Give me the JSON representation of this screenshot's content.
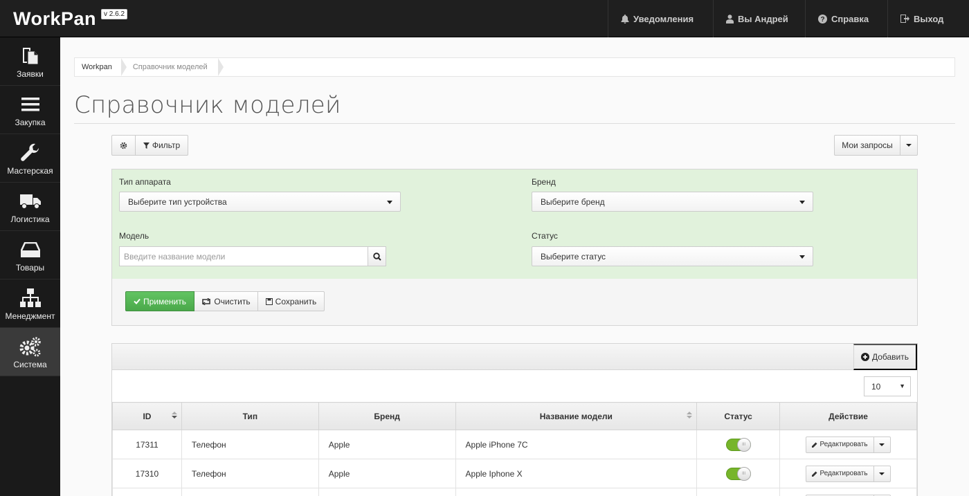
{
  "app": {
    "brand": "WorkPan",
    "version": "v 2.6.2"
  },
  "topnav": [
    {
      "label": "Уведомления",
      "icon": "bell-icon"
    },
    {
      "label": "Вы Андрей",
      "icon": "user-icon"
    },
    {
      "label": "Справка",
      "icon": "question-icon"
    },
    {
      "label": "Выход",
      "icon": "logout-icon"
    }
  ],
  "sidebar": {
    "items": [
      {
        "label": "Заявки",
        "icon": "documents-icon"
      },
      {
        "label": "Закупка",
        "icon": "menu-icon"
      },
      {
        "label": "Мастерская",
        "icon": "wrench-icon"
      },
      {
        "label": "Логистика",
        "icon": "truck-icon"
      },
      {
        "label": "Товары",
        "icon": "drive-icon"
      },
      {
        "label": "Менеджмент",
        "icon": "sitemap-icon"
      },
      {
        "label": "Система",
        "icon": "gears-icon",
        "active": true
      }
    ]
  },
  "breadcrumb": {
    "home": "Workpan",
    "current": "Справочник моделей"
  },
  "page": {
    "title": "Справочник моделей"
  },
  "toolbar": {
    "filter_label": "Фильтр",
    "saved_queries_label": "Мои запросы"
  },
  "filter": {
    "device_type": {
      "label": "Тип аппарата",
      "value": "Выберите тип устройства"
    },
    "brand": {
      "label": "Бренд",
      "value": "Выберите бренд"
    },
    "model": {
      "label": "Модель",
      "placeholder": "Введите название модели"
    },
    "status": {
      "label": "Статус",
      "value": "Выберите статус"
    },
    "apply_label": "Применить",
    "clear_label": "Очистить",
    "save_label": "Сохранить"
  },
  "table": {
    "add_label": "Добавить",
    "per_page": "10",
    "columns": [
      "ID",
      "Тип",
      "Бренд",
      "Название модели",
      "Статус",
      "Действие"
    ],
    "edit_label": "Редактировать",
    "rows": [
      {
        "id": "17311",
        "type": "Телефон",
        "brand": "Apple",
        "model": "Apple iPhone 7C",
        "active": true
      },
      {
        "id": "17310",
        "type": "Телефон",
        "brand": "Apple",
        "model": "Apple Iphone X",
        "active": true
      },
      {
        "id": "",
        "type": "",
        "brand": "",
        "model": "",
        "active": true
      }
    ]
  },
  "colors": {
    "topbar": "#1f1f1f",
    "sidebar": "#1a1a1a",
    "filter_bg": "#e1f2dc",
    "success": "#5cb85c",
    "toggle_on": "#77b52b"
  }
}
